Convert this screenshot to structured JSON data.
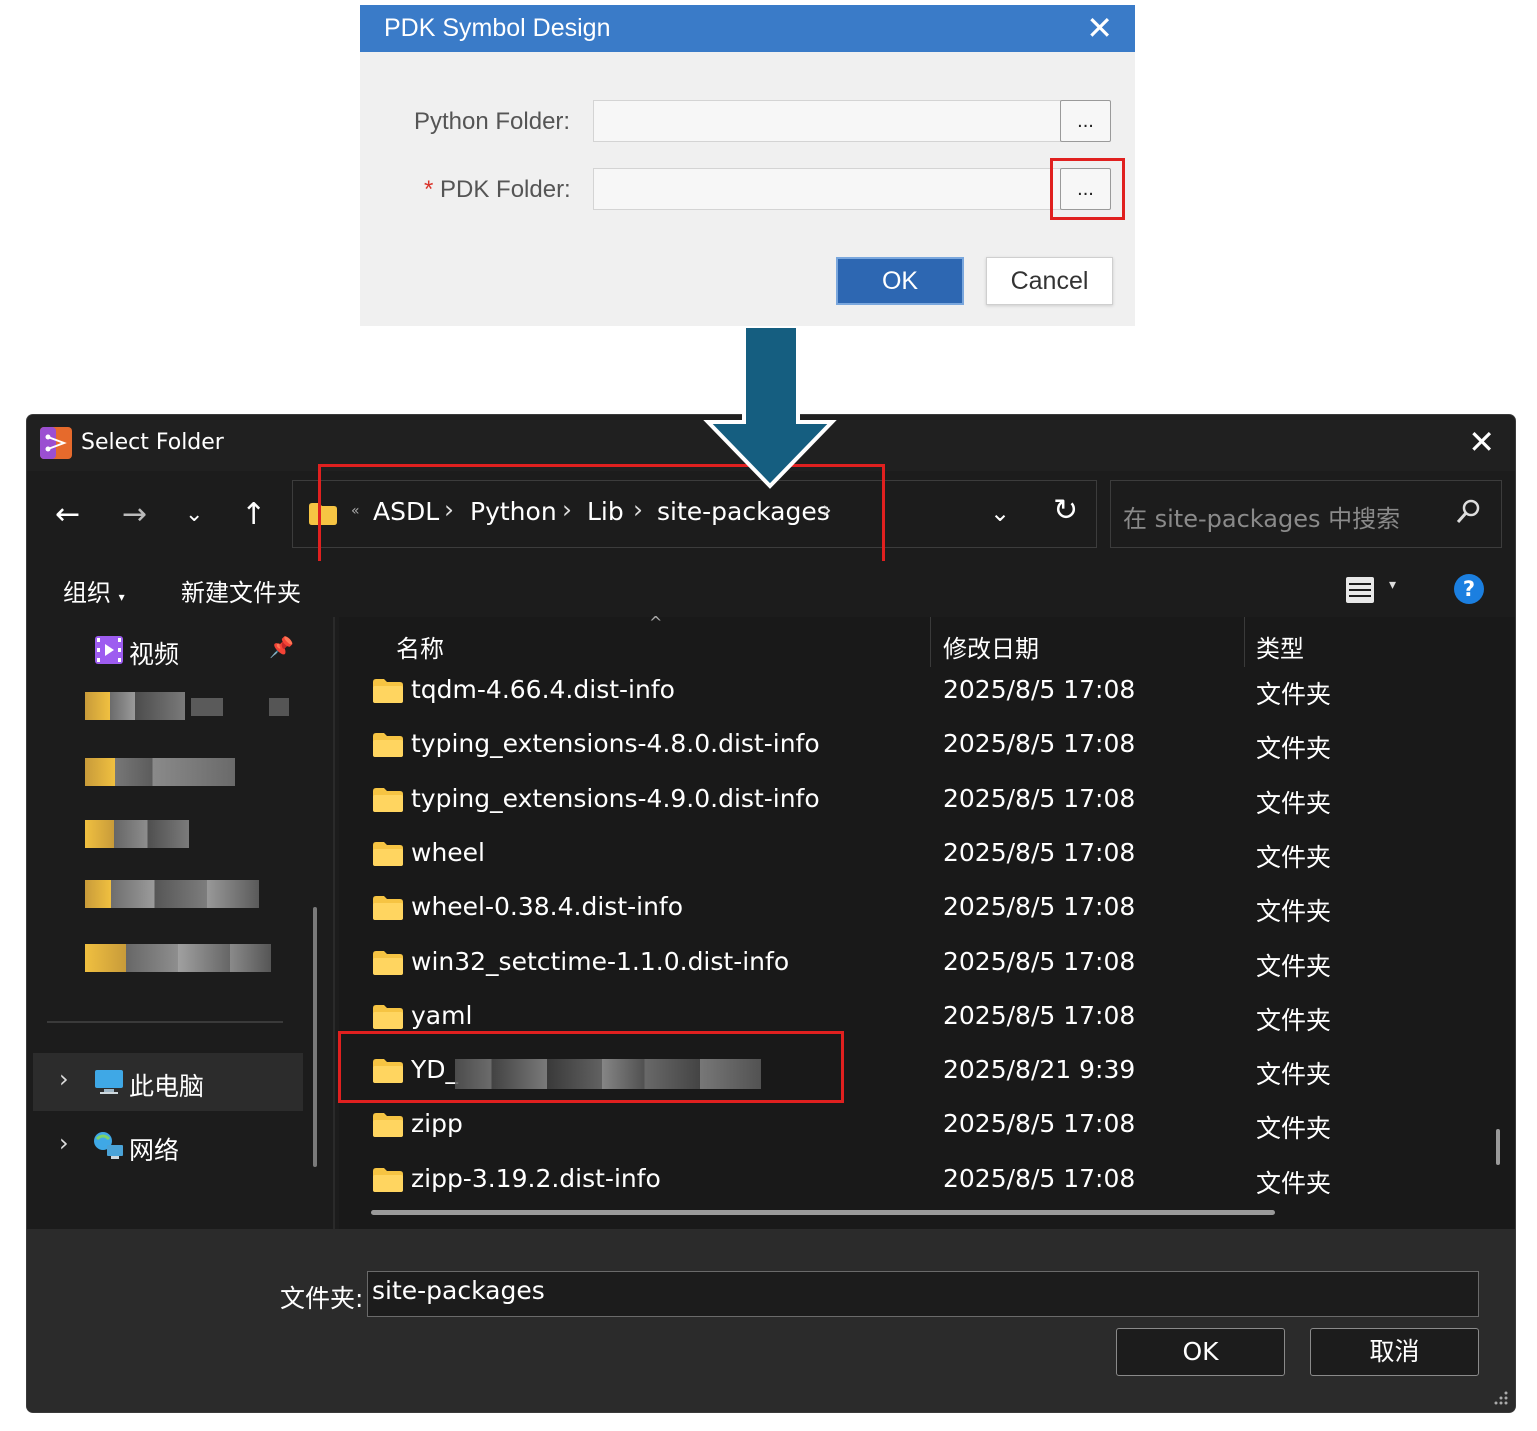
{
  "pdk_dialog": {
    "title": "PDK Symbol Design",
    "python_folder_label": "Python Folder:",
    "pdk_folder_required_mark": "*",
    "pdk_folder_label": "PDK Folder:",
    "browse_label": "...",
    "ok_label": "OK",
    "cancel_label": "Cancel"
  },
  "select_folder": {
    "title": "Select Folder",
    "breadcrumb": [
      "ASDL",
      "Python",
      "Lib",
      "site-packages"
    ],
    "breadcrumb_sep": "›",
    "search_placeholder": "在 site-packages 中搜索",
    "toolbar": {
      "organize": "组织",
      "new_folder": "新建文件夹"
    },
    "sidebar": {
      "pinned_video": "视频",
      "this_pc": "此电脑",
      "network": "网络"
    },
    "columns": {
      "name": "名称",
      "date": "修改日期",
      "type": "类型"
    },
    "rows": [
      {
        "name": "tqdm-4.66.4.dist-info",
        "date": "2025/8/5 17:08",
        "type": "文件夹"
      },
      {
        "name": "typing_extensions-4.8.0.dist-info",
        "date": "2025/8/5 17:08",
        "type": "文件夹"
      },
      {
        "name": "typing_extensions-4.9.0.dist-info",
        "date": "2025/8/5 17:08",
        "type": "文件夹"
      },
      {
        "name": "wheel",
        "date": "2025/8/5 17:08",
        "type": "文件夹"
      },
      {
        "name": "wheel-0.38.4.dist-info",
        "date": "2025/8/5 17:08",
        "type": "文件夹"
      },
      {
        "name": "win32_setctime-1.1.0.dist-info",
        "date": "2025/8/5 17:08",
        "type": "文件夹"
      },
      {
        "name": "yaml",
        "date": "2025/8/5 17:08",
        "type": "文件夹"
      },
      {
        "name": "YD_",
        "date": "2025/8/21 9:39",
        "type": "文件夹"
      },
      {
        "name": "zipp",
        "date": "2025/8/5 17:08",
        "type": "文件夹"
      },
      {
        "name": "zipp-3.19.2.dist-info",
        "date": "2025/8/5 17:08",
        "type": "文件夹"
      }
    ],
    "footer": {
      "folder_label": "文件夹:",
      "folder_value": "site-packages",
      "ok_label": "OK",
      "cancel_label": "取消"
    }
  },
  "colors": {
    "pdk_titlebar": "#3a7bc8",
    "pdk_ok": "#2d67b2",
    "highlight_box": "#e0201f",
    "arrow": "#155e80",
    "dark_bg": "#1c1c1c",
    "help_blue": "#1b7fe0",
    "folder_yellow": "#f6c443"
  }
}
